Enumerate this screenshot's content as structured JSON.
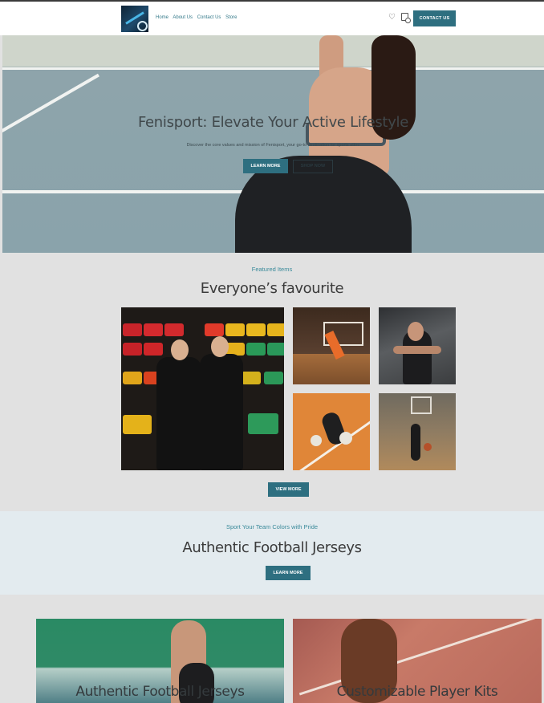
{
  "header": {
    "nav": [
      "Home",
      "About Us",
      "Contact Us",
      "Store"
    ],
    "contact_button": "CONTACT US",
    "icons": [
      "heart-icon",
      "bag-icon"
    ]
  },
  "hero": {
    "title": "Fenisport: Elevate Your Active Lifestyle",
    "subtitle": "Discover the core values and mission of Fenisport, your go-to destination for sports attire",
    "learn_more": "LEARN MORE",
    "shop_now": "SHOP NOW"
  },
  "featured": {
    "kicker": "Featured Items",
    "title": "Everyone’s favourite",
    "view_more": "VIEW MORE"
  },
  "jerseys": {
    "kicker": "Sport Your Team Colors with Pride",
    "title": "Authentic Football Jerseys",
    "learn_more": "LEARN MORE"
  },
  "cards": [
    {
      "title": "Authentic Football Jerseys"
    },
    {
      "title": "Customizable Player Kits"
    }
  ],
  "colors": {
    "accent": "#2e6f80",
    "kicker": "#3a8a9a",
    "page_bg": "#e1e1e1",
    "jersey_bg": "#e3ebef"
  }
}
